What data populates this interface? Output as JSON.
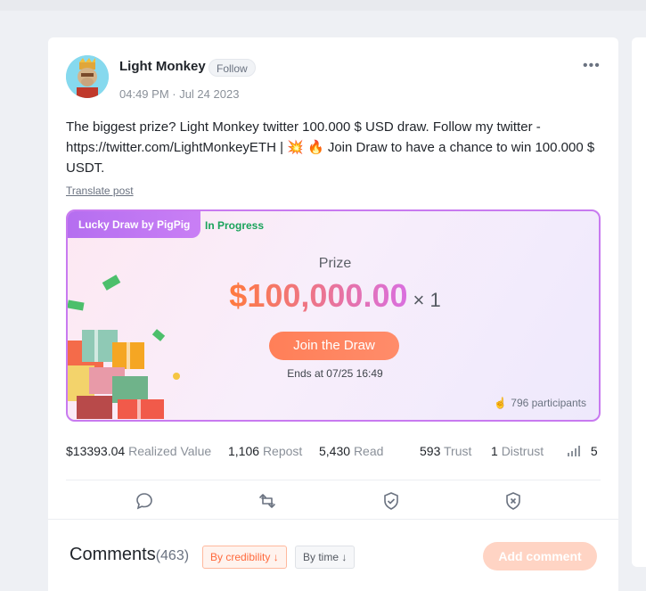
{
  "post": {
    "author": "Light Monkey",
    "follow_label": "Follow",
    "timestamp": "04:49 PM · Jul 24 2023",
    "content": "The biggest prize? Light Monkey twitter 100.000 $ USD draw. Follow my twitter - https://twitter.com/LightMonkeyETH | 💥 🔥 Join Draw to have a chance to win 100.000 $ USDT.",
    "translate_label": "Translate post"
  },
  "draw": {
    "tag": "Lucky Draw by PigPig",
    "status": "In Progress",
    "prize_label": "Prize",
    "prize_amount": "$100,000.00",
    "prize_multiplier": "× 1",
    "join_label": "Join the Draw",
    "ends": "Ends at 07/25 16:49",
    "participants": "796 participants"
  },
  "stats": {
    "realized_value": "$13393.04",
    "realized_value_label": "Realized Value",
    "repost": "1,106",
    "repost_label": "Repost",
    "read": "5,430",
    "read_label": "Read",
    "trust": "593",
    "trust_label": "Trust",
    "distrust": "1",
    "distrust_label": "Distrust",
    "signal": "5"
  },
  "comments": {
    "title": "Comments",
    "count": "(463)",
    "sort_credibility": "By credibility ↓",
    "sort_time": "By time ↓",
    "add_label": "Add comment"
  },
  "colors": {
    "accent": "#ff7f58",
    "draw_border": "#c87af0",
    "status_green": "#1aa35b"
  },
  "icons": [
    "more-icon",
    "comment-icon",
    "repost-icon",
    "trust-shield-icon",
    "distrust-icon",
    "hand-icon",
    "signal-icon"
  ]
}
